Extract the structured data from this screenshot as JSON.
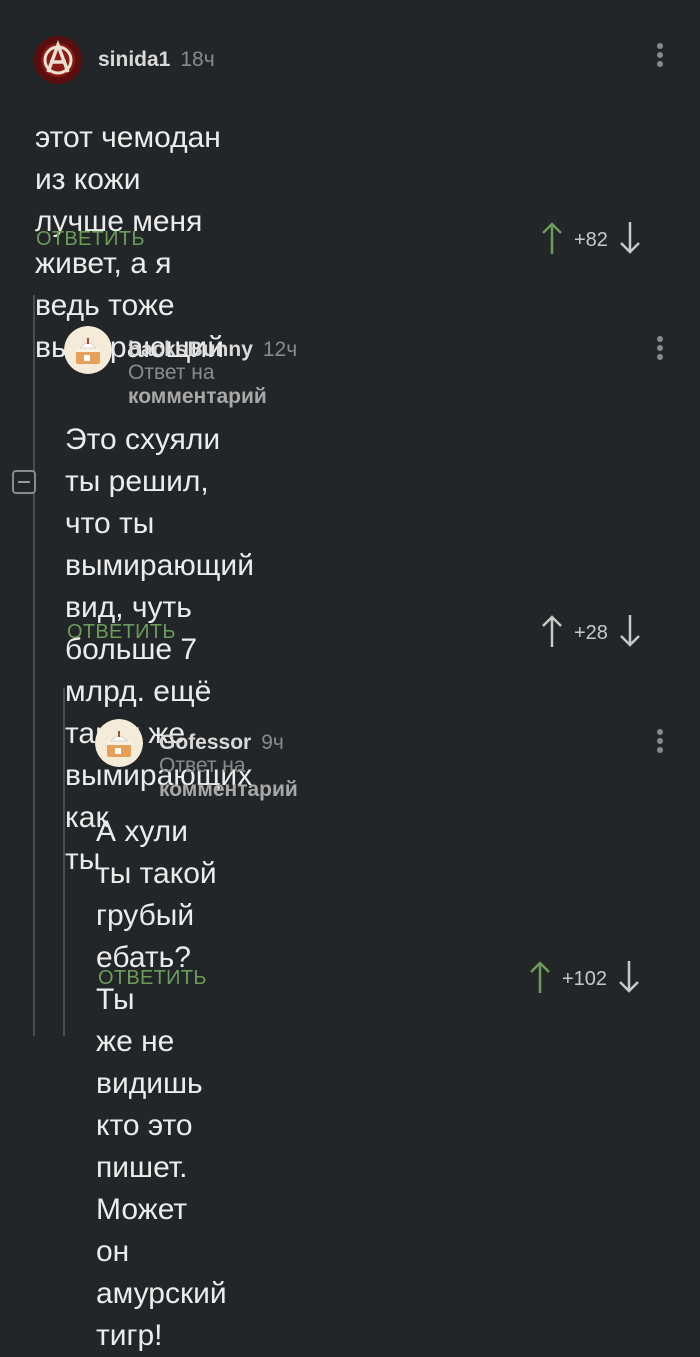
{
  "comments": [
    {
      "username": "sinida1",
      "time": "18ч",
      "text_lines": [
        "этот чемодан из кожи лучше меня",
        "живет,  а я ведь тоже вымирающий"
      ],
      "reply_label": "ответить",
      "votes": "+82"
    },
    {
      "username": "backsBunny",
      "time": "12ч",
      "reply_to_prefix": "Ответ на",
      "reply_to_target": "комментарий",
      "text_lines": [
        "Это схуяли ты решил, что ты",
        "вымирающий вид, чуть больше 7",
        "млрд. ещё таких же вымирающих как",
        "ты"
      ],
      "reply_label": "ответить",
      "votes": "+28"
    },
    {
      "username": "Gofessor",
      "time": "9ч",
      "reply_to_prefix": "Ответ на",
      "reply_to_target": "комментарий",
      "text_lines": [
        "А хули ты такой грубый ебать? Ты",
        "же не видишь кто это пишет. Может",
        "он амурский тигр!"
      ],
      "reply_label": "ответить",
      "votes": "+102"
    }
  ],
  "colors": {
    "background": "#232628",
    "reply_link": "#6c9c5a",
    "upvote_arrow": "#6c9c5a",
    "muted_text": "#8a8a8a"
  },
  "icons": [
    "anarchy-avatar-icon",
    "cake-avatar-icon",
    "more-vertical-icon",
    "arrow-up-icon",
    "arrow-down-icon",
    "collapse-minus-icon"
  ]
}
